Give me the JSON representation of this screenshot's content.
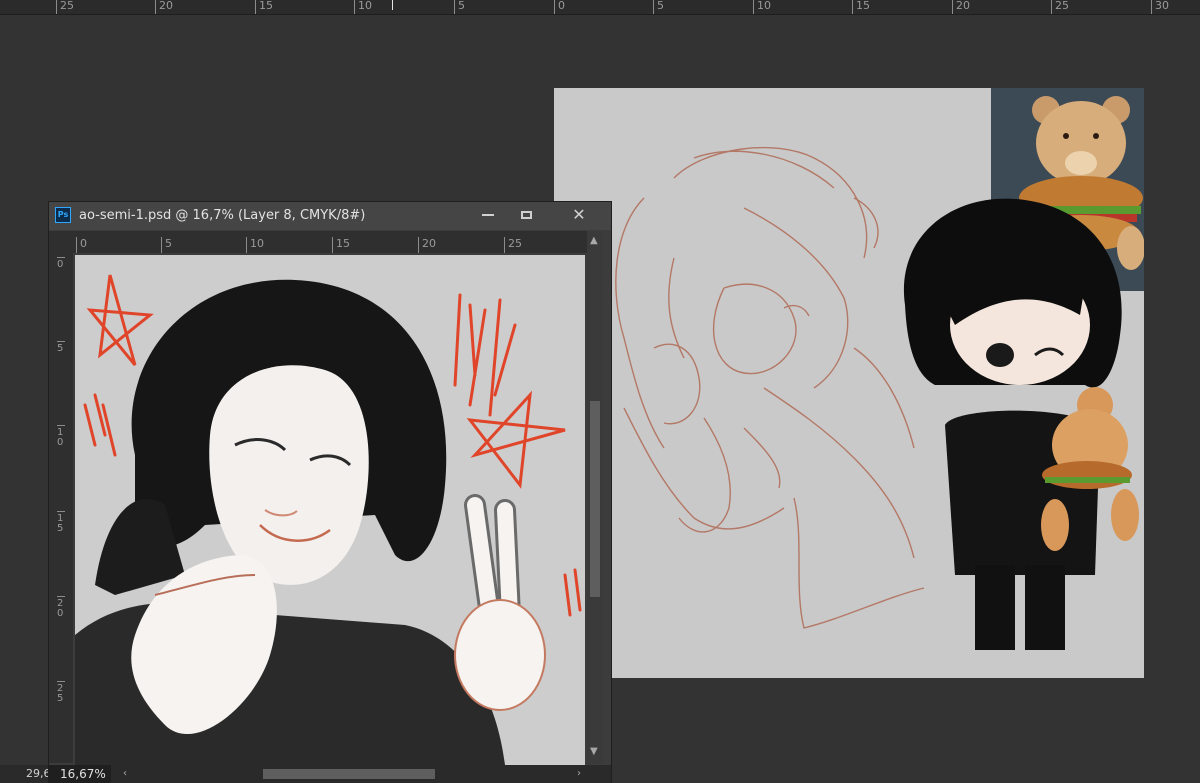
{
  "top_ruler": {
    "ticks": [
      "25",
      "20",
      "15",
      "10",
      "5",
      "0",
      "5",
      "10",
      "15",
      "20",
      "25",
      "30"
    ]
  },
  "document_window": {
    "title": "ao-semi-1.psd @ 16,7% (Layer 8, CMYK/8#)",
    "app_icon": "Ps",
    "buttons": {
      "minimize": "minimize-icon",
      "maximize": "maximize-icon",
      "close": "✕"
    },
    "h_ruler": [
      "0",
      "5",
      "10",
      "15",
      "20",
      "25"
    ],
    "v_ruler": [
      "0",
      "5",
      "10",
      "15",
      "20",
      "25"
    ],
    "zoom": "16,67%"
  },
  "status": {
    "left_value": "29,6"
  },
  "colors": {
    "workspace": "#333333",
    "canvas": "#c9c9c9",
    "sketch": "#b06a55",
    "accent_red": "#e0452a",
    "ps_blue": "#31a8ff"
  }
}
